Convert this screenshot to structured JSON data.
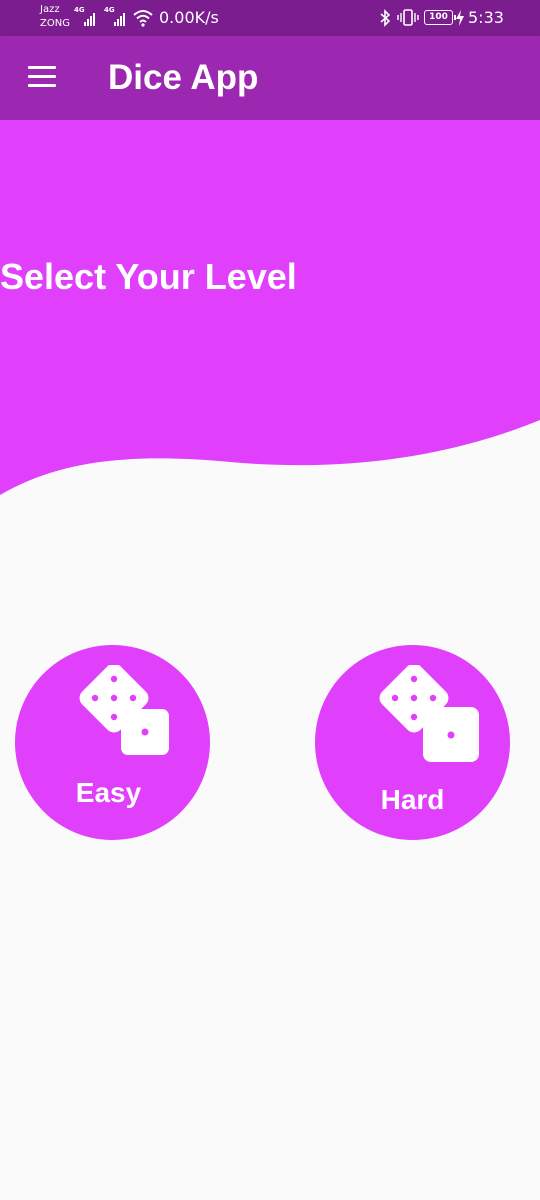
{
  "status_bar": {
    "carrier_1": "Jazz",
    "carrier_2": "ZONG",
    "network_1": "4G",
    "network_2": "4G",
    "speed": "0.00K/s",
    "battery": "100",
    "time": "5:33"
  },
  "app_bar": {
    "title": "Dice App",
    "menu_icon": "hamburger-menu-icon"
  },
  "header": {
    "title": "Select Your Level"
  },
  "levels": [
    {
      "label": "Easy",
      "icon": "dice-icon"
    },
    {
      "label": "Hard",
      "icon": "dice-icon"
    }
  ],
  "colors": {
    "status_bar": "#7b1c8f",
    "app_bar": "#9c27b0",
    "accent": "#e040fb",
    "background": "#fafafa"
  }
}
